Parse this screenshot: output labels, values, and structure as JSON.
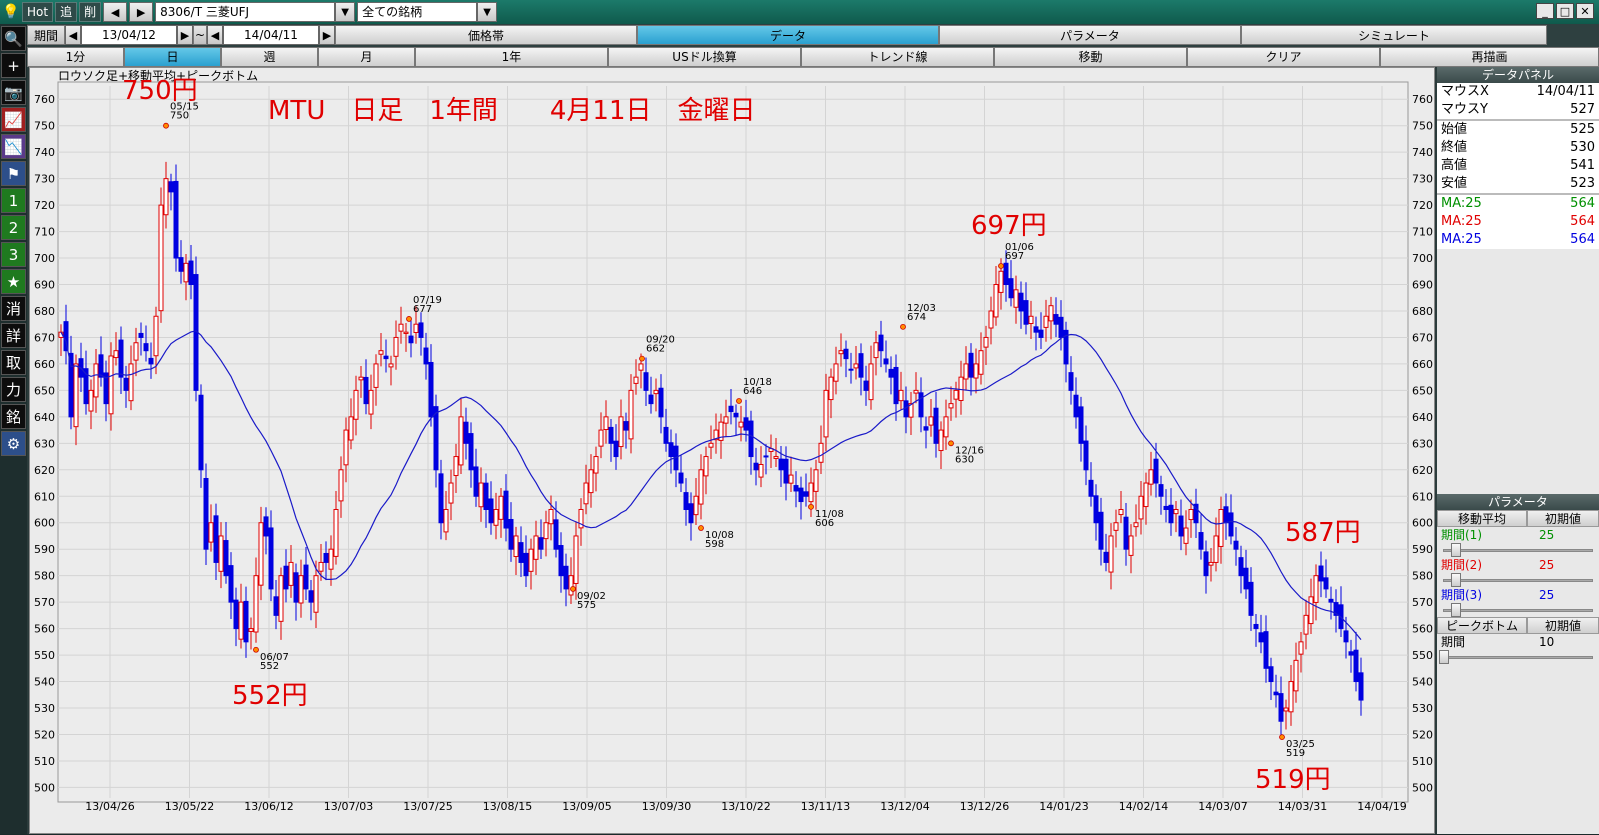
{
  "titlebar": {
    "hot": "Hot",
    "tsui": "追",
    "sakujo": "削",
    "prev_arrow": "◀",
    "next_arrow": "▶",
    "symbol": "8306/T 三菱UFJ",
    "filter": "全ての銘柄",
    "drop": "▼",
    "minimize": "_",
    "maximize": "□",
    "close": "✕"
  },
  "left_toolbar": {
    "search": "🔍",
    "plus": "+",
    "camera": "📷",
    "chart1": "📈",
    "chart2": "📉",
    "flag": "⚑",
    "n1": "1",
    "n2": "2",
    "n3": "3",
    "star": "★",
    "kesu": "消",
    "shou": "詳",
    "tori": "取",
    "chikara": "力",
    "mei": "銘",
    "gear": "⚙"
  },
  "period_row": {
    "label": "期間",
    "left_arrow": "◀",
    "start": "13/04/12",
    "right_arrow": "▶",
    "tilde": "~",
    "left_arrow2": "◀",
    "end": "14/04/11",
    "right_arrow2": "▶",
    "tabs": [
      "価格帯",
      "データ",
      "パラメータ",
      "シミュレート"
    ],
    "active_tab": 1
  },
  "range_row": {
    "tabs": [
      "1分",
      "日",
      "週",
      "月",
      "1年",
      "USドル換算",
      "トレンド線",
      "移動",
      "クリア",
      "再描画"
    ],
    "active_tab": 1
  },
  "chart": {
    "legend": "ロウソク足+移動平均+ピークボトム",
    "annotation": "MTU　日足　1年間　　4月11日　金曜日",
    "labels": {
      "p750": "750円",
      "p552": "552円",
      "p697": "697円",
      "p587": "587円",
      "p519": "519円"
    }
  },
  "data_panel": {
    "title": "データパネル",
    "mouse_x_label": "マウスX",
    "mouse_x": "14/04/11",
    "mouse_y_label": "マウスY",
    "mouse_y": "527",
    "open_label": "始値",
    "open": "525",
    "close_label": "終値",
    "close": "530",
    "high_label": "高値",
    "high": "541",
    "low_label": "安値",
    "low": "523",
    "ma1_label": "MA:25",
    "ma1": "564",
    "ma2_label": "MA:25",
    "ma2": "564",
    "ma3_label": "MA:25",
    "ma3": "564",
    "ma1_color": "#009000",
    "ma2_color": "#e00000",
    "ma3_color": "#0000e0"
  },
  "param_panel": {
    "title": "パラメータ",
    "ma_tab": "移動平均",
    "init_tab": "初期値",
    "p1_label": "期間(1)",
    "p1": "25",
    "p2_label": "期間(2)",
    "p2": "25",
    "p3_label": "期間(3)",
    "p3": "25",
    "pb_tab": "ピークボトム",
    "pb_init": "初期値",
    "pb_label": "期間",
    "pb": "10"
  },
  "chart_data": {
    "type": "candlestick",
    "y_ticks": [
      500,
      510,
      520,
      530,
      540,
      550,
      560,
      570,
      580,
      590,
      600,
      610,
      620,
      630,
      640,
      650,
      660,
      670,
      680,
      690,
      700,
      710,
      720,
      730,
      740,
      750,
      760
    ],
    "ylim": [
      496,
      765
    ],
    "x_ticks": [
      "13/04/26",
      "13/05/22",
      "13/06/12",
      "13/07/03",
      "13/07/25",
      "13/08/15",
      "13/09/05",
      "13/09/30",
      "13/10/22",
      "13/11/13",
      "13/12/04",
      "13/12/26",
      "14/01/23",
      "14/02/14",
      "14/03/07",
      "14/03/31",
      "14/04/19"
    ],
    "peaks": [
      {
        "date": "05/15",
        "value": 750
      },
      {
        "date": "06/07",
        "value": 552
      },
      {
        "date": "07/19",
        "value": 677
      },
      {
        "date": "09/02",
        "value": 575
      },
      {
        "date": "09/20",
        "value": 662
      },
      {
        "date": "10/08",
        "value": 598
      },
      {
        "date": "10/18",
        "value": 646
      },
      {
        "date": "11/08",
        "value": 606
      },
      {
        "date": "12/03",
        "value": 674
      },
      {
        "date": "12/16",
        "value": 630
      },
      {
        "date": "01/06",
        "value": 697
      },
      {
        "date": "03/25",
        "value": 519
      }
    ]
  }
}
